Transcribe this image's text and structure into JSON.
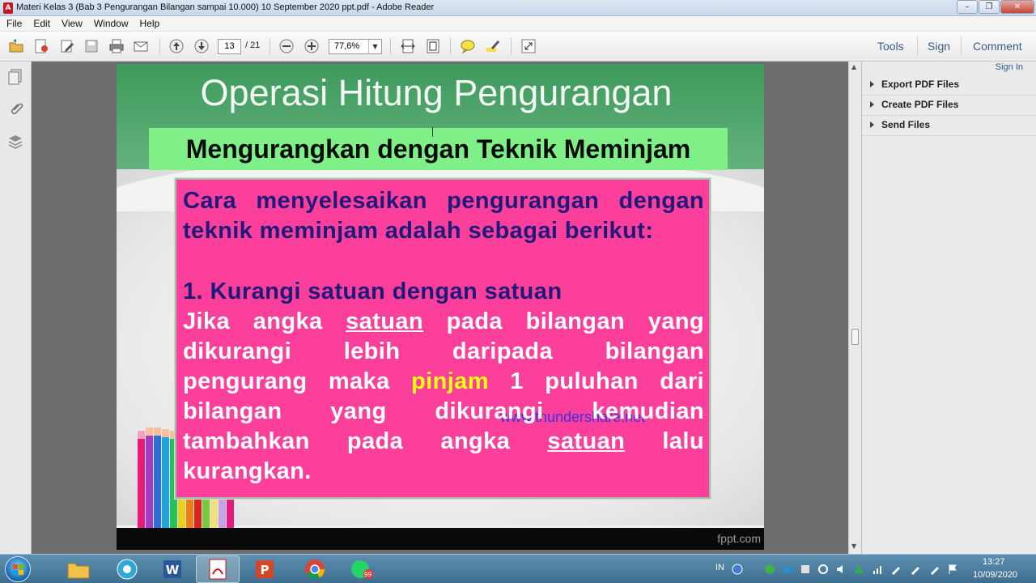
{
  "window": {
    "title": "Materi Kelas 3 (Bab 3 Pengurangan Bilangan sampai 10.000) 10 September 2020 ppt.pdf - Adobe Reader",
    "minimize": "–",
    "maximize": "❐",
    "close": "✕"
  },
  "menu": [
    "File",
    "Edit",
    "View",
    "Window",
    "Help"
  ],
  "toolbar": {
    "page_current": "13",
    "page_total": "/ 21",
    "zoom": "77,6%",
    "tools_label": "Tools",
    "sign_label": "Sign",
    "comment_label": "Comment"
  },
  "right_pane": {
    "sign_in": "Sign In",
    "items": [
      "Export PDF Files",
      "Create PDF Files",
      "Send Files"
    ]
  },
  "slide": {
    "title": "Operasi Hitung Pengurangan",
    "subtitle": "Mengurangkan dengan Teknik Meminjam",
    "intro_line1": [
      "Cara",
      "menyelesaikan",
      "pengurangan",
      "dengan"
    ],
    "intro_line2": "teknik meminjam adalah sebagai berikut:",
    "step1": "1.  Kurangi satuan dengan satuan",
    "watermark": "www.thundershare.net",
    "body": {
      "l1_a": "Jika",
      "l1_b": "angka",
      "l1_c": "satuan",
      "l1_d": "pada",
      "l1_e": "bilangan",
      "l1_f": "yang",
      "l2_a": "dikurangi",
      "l2_b": "lebih",
      "l2_c": "daripada",
      "l2_d": "bilangan",
      "l3_a": "pengurang",
      "l3_b": "maka",
      "l3_c": "pinjam",
      "l3_d": "1",
      "l3_e": "puluhan",
      "l3_f": "dari",
      "l4_a": "bilangan",
      "l4_b": "yang",
      "l4_c": "dikurangi",
      "l4_d": "kemudian",
      "l5_a": "tambahkan",
      "l5_b": "pada",
      "l5_c": "angka",
      "l5_d": "satuan",
      "l5_e": "lalu",
      "l6": "kurangkan."
    },
    "footer_mark": "fppt.com"
  },
  "taskbar": {
    "lang": "IN",
    "time": "13:27",
    "date": "10/09/2020",
    "whatsapp_badge": "99"
  },
  "colors": {
    "slide_green": "#3d9a5c",
    "band_green": "#7ef087",
    "pink": "#fb3f9b",
    "navy_text": "#1f1a7a",
    "highlight_yellow": "#ffff10"
  }
}
